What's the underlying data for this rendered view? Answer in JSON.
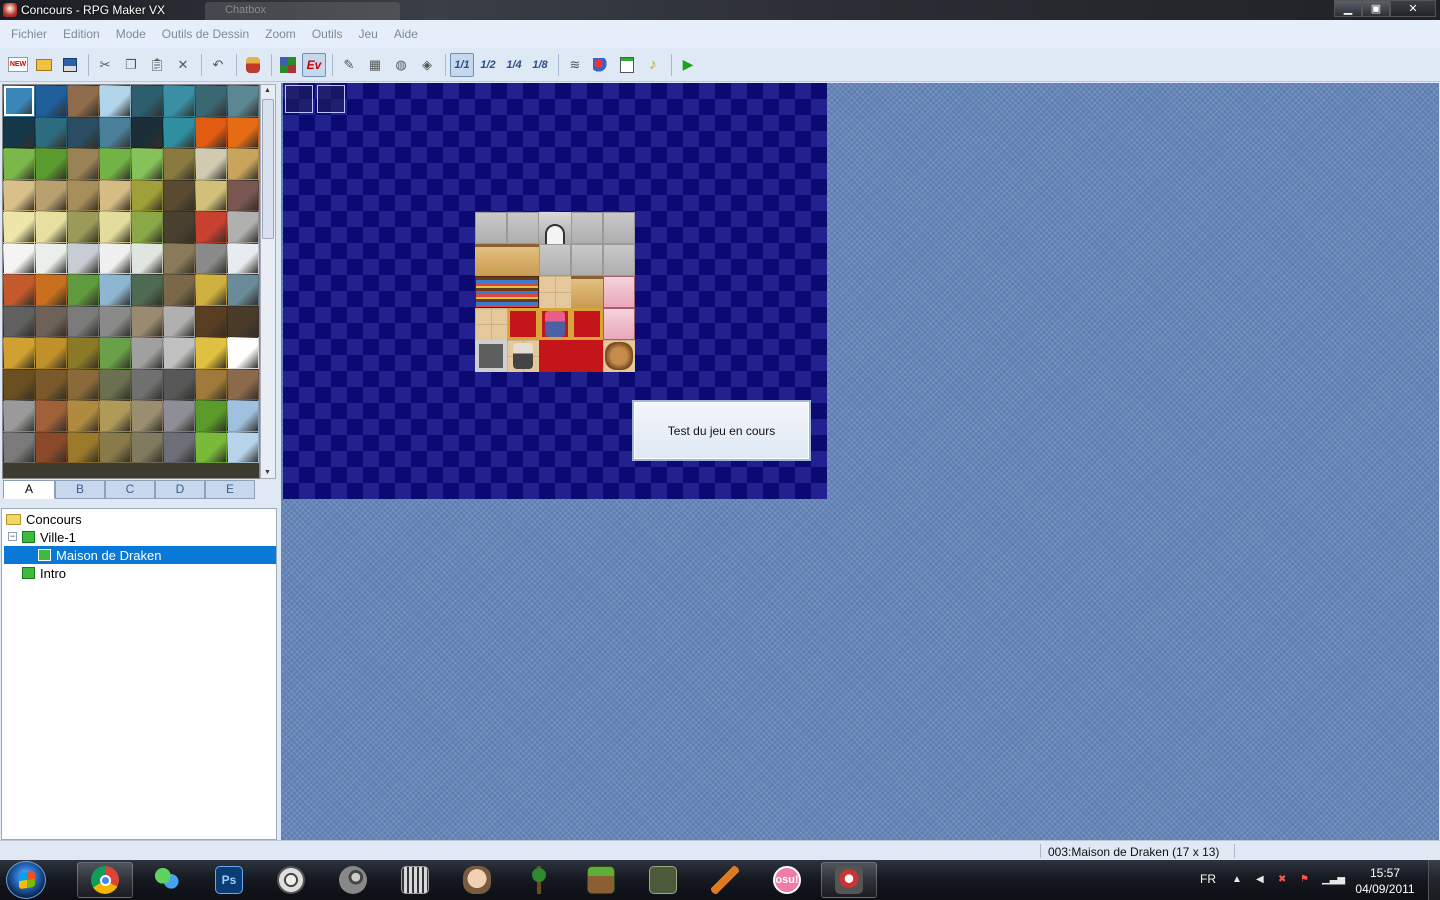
{
  "window": {
    "title": "Concours - RPG Maker VX",
    "ghost_tab": "Chatbox",
    "buttons": [
      "minimize",
      "maximize",
      "close"
    ]
  },
  "menu": [
    "Fichier",
    "Edition",
    "Mode",
    "Outils de Dessin",
    "Zoom",
    "Outils",
    "Jeu",
    "Aide"
  ],
  "toolbar": {
    "new": "NEW",
    "event_mode": "Ev",
    "zoom_1_1": "1/1",
    "zoom_1_2": "1/2",
    "zoom_1_4": "1/4",
    "zoom_1_8": "1/8",
    "play": "▶"
  },
  "palette_tabs": [
    "A",
    "B",
    "C",
    "D",
    "E"
  ],
  "active_palette_tab": "A",
  "map_tree": {
    "project": "Concours",
    "maps": [
      {
        "name": "Ville-1",
        "level": 1,
        "expander": "−"
      },
      {
        "name": "Maison de Draken",
        "level": 2,
        "selected": true
      },
      {
        "name": "Intro",
        "level": 1
      }
    ]
  },
  "test_dialog": "Test du jeu en cours",
  "status": "003:Maison de Draken (17 x 13)",
  "taskbar": {
    "language": "FR",
    "time": "15:57",
    "date": "04/09/2011",
    "apps": [
      "chrome",
      "messenger",
      "photoshop",
      "media-center",
      "steam",
      "pix",
      "avatar",
      "terraria",
      "minecraft",
      "game",
      "paint",
      "osu",
      "rpg-maker"
    ],
    "osu_label": "osu!",
    "ps_label": "Ps"
  },
  "colors": {
    "selection": "#0a78d7",
    "map_bg": "#0c0c78",
    "workspace": "#5f7fb3"
  }
}
